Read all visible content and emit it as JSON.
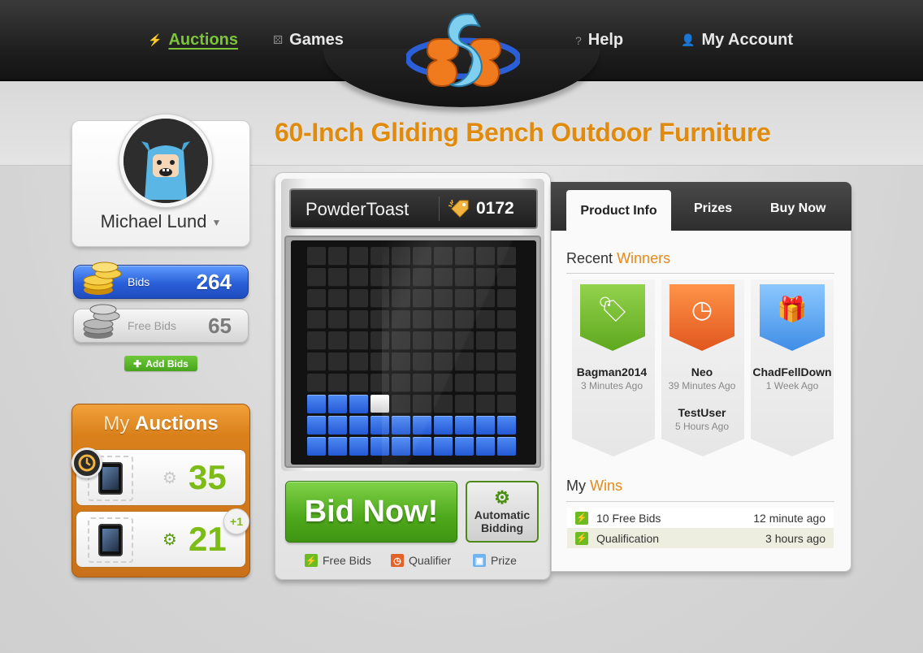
{
  "nav": {
    "auctions": "Auctions",
    "games": "Games",
    "help": "Help",
    "account": "My Account",
    "icons": [
      "bolt-icon",
      "dice-icon",
      "help-icon",
      "user-icon"
    ]
  },
  "logo": {
    "text": "SB"
  },
  "profile": {
    "name": "Michael Lund"
  },
  "bids": {
    "paid_label": "Bids",
    "paid_value": "264",
    "free_label": "Free Bids",
    "free_value": "65",
    "add_label": "Add Bids"
  },
  "my_auctions": {
    "title_prefix": "My",
    "title_bold": "Auctions",
    "items": [
      {
        "count": "35"
      },
      {
        "count": "21",
        "badge": "+1"
      }
    ]
  },
  "product": {
    "title": "60-Inch Gliding Bench Outdoor Furniture"
  },
  "game": {
    "leader": "PowderToast",
    "counter": "0172",
    "bid_button": "Bid Now!",
    "auto_line1": "Automatic",
    "auto_line2": "Bidding",
    "legend": [
      {
        "label": "Free Bids",
        "color": "#6dbb22"
      },
      {
        "label": "Qualifier",
        "color": "#e2622a"
      },
      {
        "label": "Prize",
        "color": "#6fb3f0"
      }
    ],
    "grid_cols": 10,
    "grid_rows": 10,
    "filled_rows": [
      {
        "row": 7,
        "blue": [
          0,
          1,
          2
        ],
        "white": [
          3
        ]
      },
      {
        "row": 8,
        "blue": [
          0,
          1,
          2,
          3,
          4,
          5,
          6,
          7,
          8,
          9
        ],
        "white": []
      },
      {
        "row": 9,
        "blue": [
          0,
          1,
          2,
          3,
          4,
          5,
          6,
          7,
          8,
          9
        ],
        "white": []
      }
    ]
  },
  "tabs": {
    "product_info": "Product Info",
    "prizes": "Prizes",
    "buy_now": "Buy Now"
  },
  "recent_winners": {
    "title_prefix": "Recent",
    "title_accent": "Winners",
    "winners": [
      {
        "name": "Bagman2014",
        "time": "3 Minutes Ago",
        "icon": "tag-icon",
        "color": "green"
      },
      {
        "name": "Neo",
        "time": "39 Minutes Ago",
        "name2": "TestUser",
        "time2": "5 Hours Ago",
        "icon": "timer-icon",
        "color": "orange"
      },
      {
        "name": "ChadFellDown",
        "time": "1 Week Ago",
        "icon": "gift-icon",
        "color": "blue"
      }
    ]
  },
  "my_wins": {
    "title_prefix": "My",
    "title_accent": "Wins",
    "rows": [
      {
        "label": "10 Free Bids",
        "time": "12 minute ago"
      },
      {
        "label": "Qualification",
        "time": "3 hours ago"
      }
    ]
  }
}
